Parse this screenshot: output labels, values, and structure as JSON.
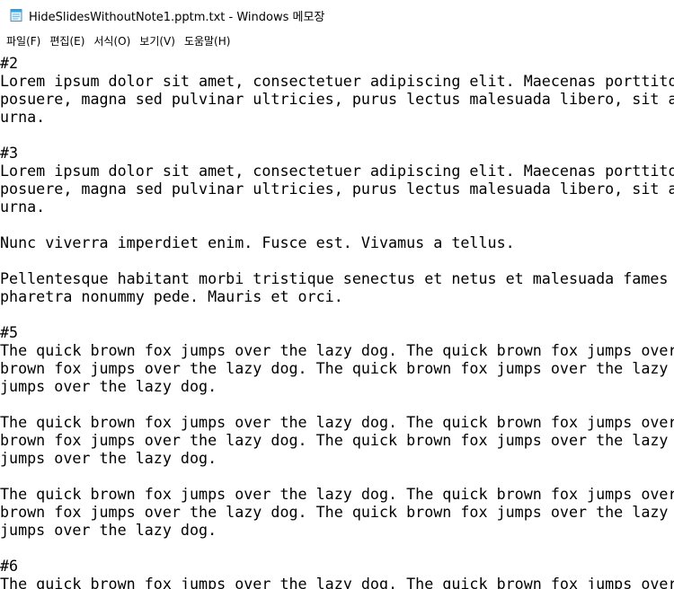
{
  "window": {
    "title": "HideSlidesWithoutNote1.pptm.txt - Windows 메모장",
    "icon": "notepad-icon"
  },
  "menu": [
    {
      "id": "file",
      "label": "파일(F)"
    },
    {
      "id": "edit",
      "label": "편집(E)"
    },
    {
      "id": "format",
      "label": "서식(O)"
    },
    {
      "id": "view",
      "label": "보기(V)"
    },
    {
      "id": "help",
      "label": "도움말(H)"
    }
  ],
  "editor": {
    "lines": [
      "#2",
      "Lorem ipsum dolor sit amet, consectetuer adipiscing elit. Maecenas porttitor co",
      "posuere, magna sed pulvinar ultricies, purus lectus malesuada libero, sit amet",
      "urna.",
      "",
      "#3",
      "Lorem ipsum dolor sit amet, consectetuer adipiscing elit. Maecenas porttitor co",
      "posuere, magna sed pulvinar ultricies, purus lectus malesuada libero, sit amet",
      "urna.",
      "",
      "Nunc viverra imperdiet enim. Fusce est. Vivamus a tellus.",
      "",
      "Pellentesque habitant morbi tristique senectus et netus et malesuada fames ac t",
      "pharetra nonummy pede. Mauris et orci.",
      "",
      "#5",
      "The quick brown fox jumps over the lazy dog. The quick brown fox jumps over the",
      "brown fox jumps over the lazy dog. The quick brown fox jumps over the lazy dog.",
      "jumps over the lazy dog.",
      "",
      "The quick brown fox jumps over the lazy dog. The quick brown fox jumps over the",
      "brown fox jumps over the lazy dog. The quick brown fox jumps over the lazy dog.",
      "jumps over the lazy dog.",
      "",
      "The quick brown fox jumps over the lazy dog. The quick brown fox jumps over the",
      "brown fox jumps over the lazy dog. The quick brown fox jumps over the lazy dog.",
      "jumps over the lazy dog.",
      "",
      "#6",
      "The quick brown fox jumps over the lazy dog. The quick brown fox jumps over the"
    ]
  }
}
